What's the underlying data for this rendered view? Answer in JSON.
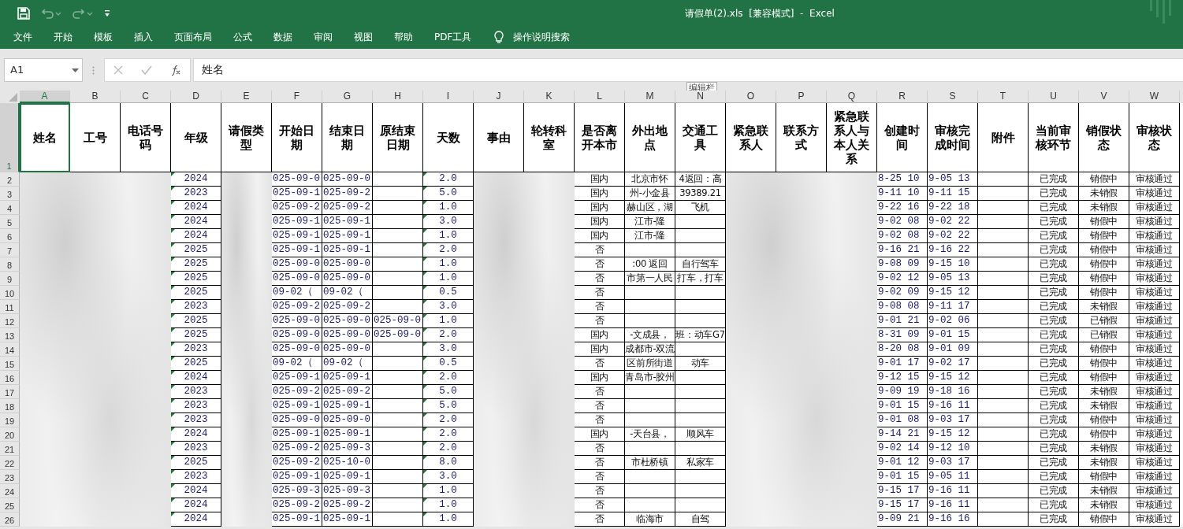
{
  "window": {
    "title": "请假单(2).xls  [兼容模式]  -  Excel"
  },
  "quick_access": {
    "undo_disabled": true,
    "redo_disabled": true
  },
  "menu": [
    {
      "label": "文件"
    },
    {
      "label": "开始"
    },
    {
      "label": "模板"
    },
    {
      "label": "插入"
    },
    {
      "label": "页面布局"
    },
    {
      "label": "公式"
    },
    {
      "label": "数据"
    },
    {
      "label": "审阅"
    },
    {
      "label": "视图"
    },
    {
      "label": "帮助"
    },
    {
      "label": "PDF工具"
    }
  ],
  "tell_me": "操作说明搜索",
  "formula_bar": {
    "name_box": "A1",
    "value": "姓名",
    "tooltip": "编辑栏"
  },
  "columns": [
    {
      "letter": "A",
      "header": "姓名",
      "selected": true
    },
    {
      "letter": "B",
      "header": "工号",
      "selected": false
    },
    {
      "letter": "C",
      "header": "电话号码",
      "selected": false
    },
    {
      "letter": "D",
      "header": "年级",
      "selected": false
    },
    {
      "letter": "E",
      "header": "请假类型",
      "selected": false
    },
    {
      "letter": "F",
      "header": "开始日期",
      "selected": false
    },
    {
      "letter": "G",
      "header": "结束日期",
      "selected": false
    },
    {
      "letter": "H",
      "header": "原结束日期",
      "selected": false
    },
    {
      "letter": "I",
      "header": "天数",
      "selected": false
    },
    {
      "letter": "J",
      "header": "事由",
      "selected": false
    },
    {
      "letter": "K",
      "header": "轮转科室",
      "selected": false
    },
    {
      "letter": "L",
      "header": "是否离开本市",
      "selected": false
    },
    {
      "letter": "M",
      "header": "外出地点",
      "selected": false
    },
    {
      "letter": "N",
      "header": "交通工具",
      "selected": false
    },
    {
      "letter": "O",
      "header": "紧急联系人",
      "selected": false
    },
    {
      "letter": "P",
      "header": "联系方式",
      "selected": false
    },
    {
      "letter": "Q",
      "header": "紧急联系人与本人关系",
      "selected": false
    },
    {
      "letter": "R",
      "header": "创建时间",
      "selected": false
    },
    {
      "letter": "S",
      "header": "审核完成时间",
      "selected": false
    },
    {
      "letter": "T",
      "header": "附件",
      "selected": false
    },
    {
      "letter": "U",
      "header": "当前审核环节",
      "selected": false
    },
    {
      "letter": "V",
      "header": "销假状态",
      "selected": false
    },
    {
      "letter": "W",
      "header": "审核状态",
      "selected": false
    }
  ],
  "header_row_number": "1",
  "rows": [
    {
      "n": "2",
      "year": "2024",
      "start": "025-09-0",
      "end": "025-09-0",
      "days": "2.0",
      "scope": "国内",
      "place": "北京市怀",
      "transport": "4返回：高",
      "created": "8-25 10",
      "done": "9-05 13",
      "stage": "已完成",
      "cancel": "销假中",
      "review": "审核通过"
    },
    {
      "n": "3",
      "year": "2023",
      "start": "025-09-1",
      "end": "025-09-2",
      "days": "5.0",
      "scope": "国内",
      "place": "州-小金县",
      "transport": "39389.21",
      "created": "9-11 10",
      "done": "9-11 15",
      "stage": "已完成",
      "cancel": "未销假",
      "review": "审核通过"
    },
    {
      "n": "4",
      "year": "2024",
      "start": "025-09-2",
      "end": "025-09-2",
      "days": "1.0",
      "scope": "国内",
      "place": "赫山区，湖",
      "transport": "飞机",
      "created": "9-22 16",
      "done": "9-22 18",
      "stage": "已完成",
      "cancel": "未销假",
      "review": "审核通过"
    },
    {
      "n": "5",
      "year": "2024",
      "start": "025-09-1",
      "end": "025-09-1",
      "days": "3.0",
      "scope": "国内",
      "place": "江市-隆",
      "created": "9-02 08",
      "done": "9-02 22",
      "stage": "已完成",
      "cancel": "销假中",
      "review": "审核通过"
    },
    {
      "n": "6",
      "year": "2024",
      "start": "025-09-1",
      "end": "025-09-1",
      "days": "1.0",
      "scope": "国内",
      "place": "江市-隆",
      "created": "9-02 08",
      "done": "9-02 22",
      "stage": "已完成",
      "cancel": "销假中",
      "review": "审核通过"
    },
    {
      "n": "7",
      "year": "2025",
      "start": "025-09-1",
      "end": "025-09-1",
      "days": "2.0",
      "scope": "否",
      "created": "9-16 21",
      "done": "9-16 22",
      "stage": "已完成",
      "cancel": "销假中",
      "review": "审核通过"
    },
    {
      "n": "8",
      "year": "2025",
      "start": "025-09-0",
      "end": "025-09-0",
      "days": "1.0",
      "scope": "否",
      "place": ":00 返回",
      "transport": "自行驾车",
      "created": "9-08 09",
      "done": "9-15 10",
      "stage": "已完成",
      "cancel": "销假中",
      "review": "审核通过"
    },
    {
      "n": "9",
      "year": "2025",
      "start": "025-09-0",
      "end": "025-09-0",
      "days": "1.0",
      "scope": "否",
      "place": "市第一人民",
      "transport": "打车，打车",
      "created": "9-02 12",
      "done": "9-05 13",
      "stage": "已完成",
      "cancel": "销假中",
      "review": "审核通过"
    },
    {
      "n": "10",
      "year": "2025",
      "start": "09-02（",
      "end": "09-02（",
      "days": "0.5",
      "scope": "否",
      "created": "9-02 09",
      "done": "9-15 12",
      "stage": "已完成",
      "cancel": "销假中",
      "review": "审核通过"
    },
    {
      "n": "11",
      "year": "2023",
      "start": "025-09-2",
      "end": "025-09-2",
      "days": "3.0",
      "scope": "否",
      "created": "9-08 08",
      "done": "9-11 17",
      "stage": "已完成",
      "cancel": "未销假",
      "review": "审核通过"
    },
    {
      "n": "12",
      "year": "2025",
      "start": "025-09-0",
      "end": "025-09-0",
      "orig_end": "025-09-0",
      "days": "1.0",
      "scope": "否",
      "created": "9-01 21",
      "done": "9-02 06",
      "stage": "已完成",
      "cancel": "已销假",
      "review": "审核通过"
    },
    {
      "n": "13",
      "year": "2025",
      "start": "025-09-0",
      "end": "025-09-0",
      "orig_end": "025-09-0",
      "days": "2.0",
      "scope": "国内",
      "place": "-文成县，",
      "transport": "班：动车G7",
      "created": "8-31 09",
      "done": "9-01 15",
      "stage": "已完成",
      "cancel": "已销假",
      "review": "审核通过"
    },
    {
      "n": "14",
      "year": "2023",
      "start": "025-09-0",
      "end": "025-09-0",
      "days": "3.0",
      "scope": "国内",
      "place": "成都市-双流",
      "created": "8-20 08",
      "done": "9-01 09",
      "stage": "已完成",
      "cancel": "销假中",
      "review": "审核通过"
    },
    {
      "n": "15",
      "year": "2025",
      "start": "09-02（",
      "end": "09-02（",
      "days": "0.5",
      "scope": "否",
      "place": "区前所街道",
      "transport": "动车",
      "created": "9-01 17",
      "done": "9-02 17",
      "stage": "已完成",
      "cancel": "销假中",
      "review": "审核通过"
    },
    {
      "n": "16",
      "year": "2024",
      "start": "025-09-1",
      "end": "025-09-1",
      "days": "2.0",
      "scope": "国内",
      "place": "青岛市-胶州",
      "created": "9-12 15",
      "done": "9-15 12",
      "stage": "已完成",
      "cancel": "销假中",
      "review": "审核通过"
    },
    {
      "n": "17",
      "year": "2023",
      "start": "025-09-2",
      "end": "025-09-2",
      "days": "5.0",
      "scope": "否",
      "created": "9-09 19",
      "done": "9-18 16",
      "stage": "已完成",
      "cancel": "未销假",
      "review": "审核通过"
    },
    {
      "n": "18",
      "year": "2023",
      "start": "025-09-1",
      "end": "025-09-1",
      "days": "5.0",
      "scope": "否",
      "created": "9-01 15",
      "done": "9-16 11",
      "stage": "已完成",
      "cancel": "未销假",
      "review": "审核通过"
    },
    {
      "n": "19",
      "year": "2023",
      "start": "025-09-0",
      "end": "025-09-0",
      "days": "2.0",
      "scope": "否",
      "created": "9-01 08",
      "done": "9-03 17",
      "stage": "已完成",
      "cancel": "销假中",
      "review": "审核通过"
    },
    {
      "n": "20",
      "year": "2024",
      "start": "025-09-1",
      "end": "025-09-1",
      "days": "2.0",
      "scope": "国内",
      "place": "-天台县，",
      "transport": "顺风车",
      "created": "9-14 21",
      "done": "9-15 12",
      "stage": "已完成",
      "cancel": "销假中",
      "review": "审核通过"
    },
    {
      "n": "21",
      "year": "2023",
      "start": "025-09-2",
      "end": "025-09-3",
      "days": "2.0",
      "scope": "否",
      "created": "9-02 14",
      "done": "9-12 10",
      "stage": "已完成",
      "cancel": "未销假",
      "review": "审核通过"
    },
    {
      "n": "22",
      "year": "2025",
      "start": "025-09-2",
      "end": "025-10-0",
      "days": "8.0",
      "scope": "否",
      "place": "市杜桥镇",
      "transport": "私家车",
      "created": "9-01 12",
      "done": "9-03 17",
      "stage": "已完成",
      "cancel": "未销假",
      "review": "审核通过"
    },
    {
      "n": "23",
      "year": "2023",
      "start": "025-09-1",
      "end": "025-09-1",
      "days": "3.0",
      "scope": "否",
      "created": "9-01 15",
      "done": "9-05 11",
      "stage": "已完成",
      "cancel": "销假中",
      "review": "审核通过"
    },
    {
      "n": "24",
      "year": "2024",
      "start": "025-09-3",
      "end": "025-09-3",
      "days": "1.0",
      "scope": "否",
      "created": "9-15 17",
      "done": "9-16 11",
      "stage": "已完成",
      "cancel": "未销假",
      "review": "审核通过"
    },
    {
      "n": "25",
      "year": "2024",
      "start": "025-09-2",
      "end": "025-09-2",
      "days": "1.0",
      "scope": "否",
      "created": "9-15 17",
      "done": "9-16 11",
      "stage": "已完成",
      "cancel": "未销假",
      "review": "审核通过"
    },
    {
      "n": "26",
      "year": "2024",
      "start": "025-09-1",
      "end": "025-09-1",
      "days": "1.0",
      "scope": "否",
      "place": "临海市",
      "transport": "自驾",
      "created": "9-09 21",
      "done": "9-16 16",
      "stage": "已完成",
      "cancel": "销假中",
      "review": "审核通过"
    }
  ]
}
